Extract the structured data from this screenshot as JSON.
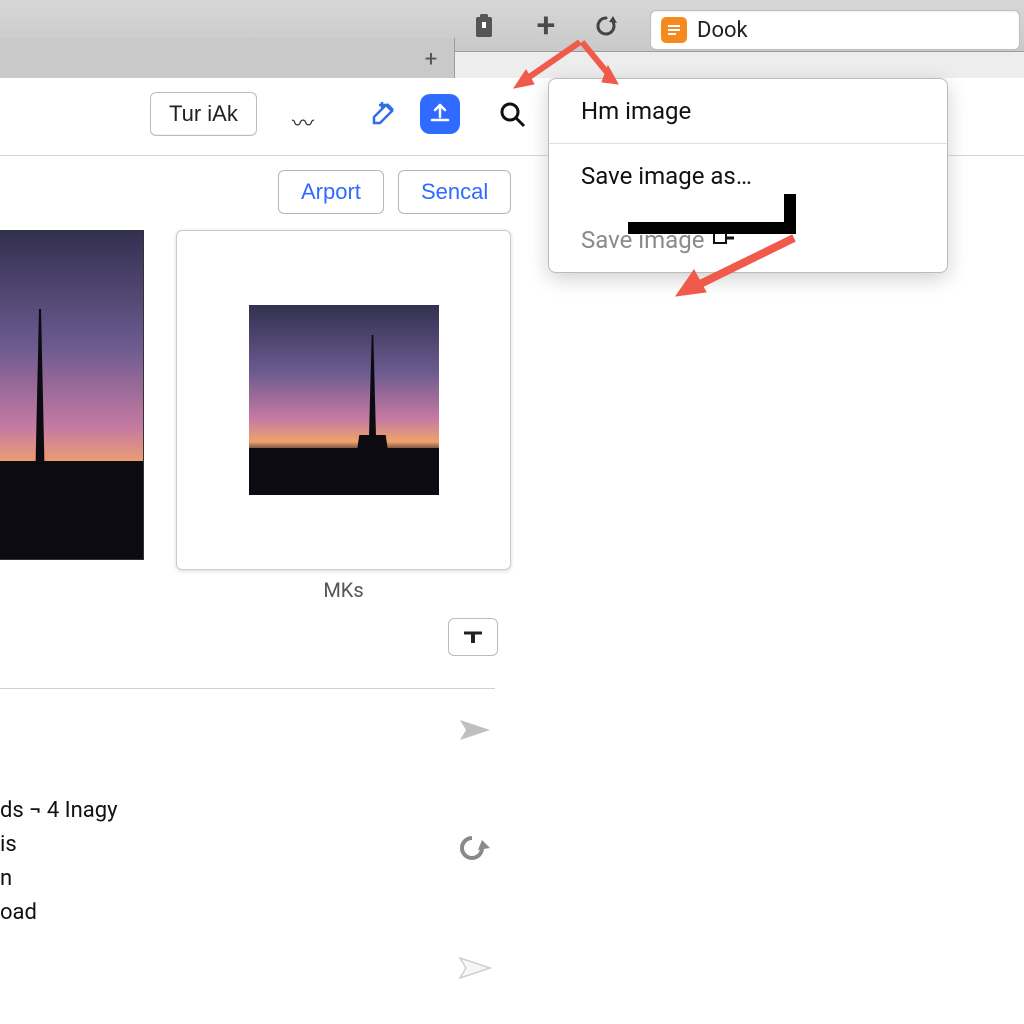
{
  "browser": {
    "address_text": "Dook"
  },
  "toolbar": {
    "dropdown_label": "Tur iAk",
    "pill_arport": "Arport",
    "pill_sencal": "Sencal"
  },
  "thumb": {
    "caption": "MKs"
  },
  "context_menu": {
    "item_top": "Hm image",
    "item_save_as": "Save image as…",
    "item_disabled": "Save image"
  },
  "textlines": {
    "l1": "ds ¬ 4 Inagy",
    "l2": "is",
    "l3": "n",
    "l4": "oad"
  }
}
